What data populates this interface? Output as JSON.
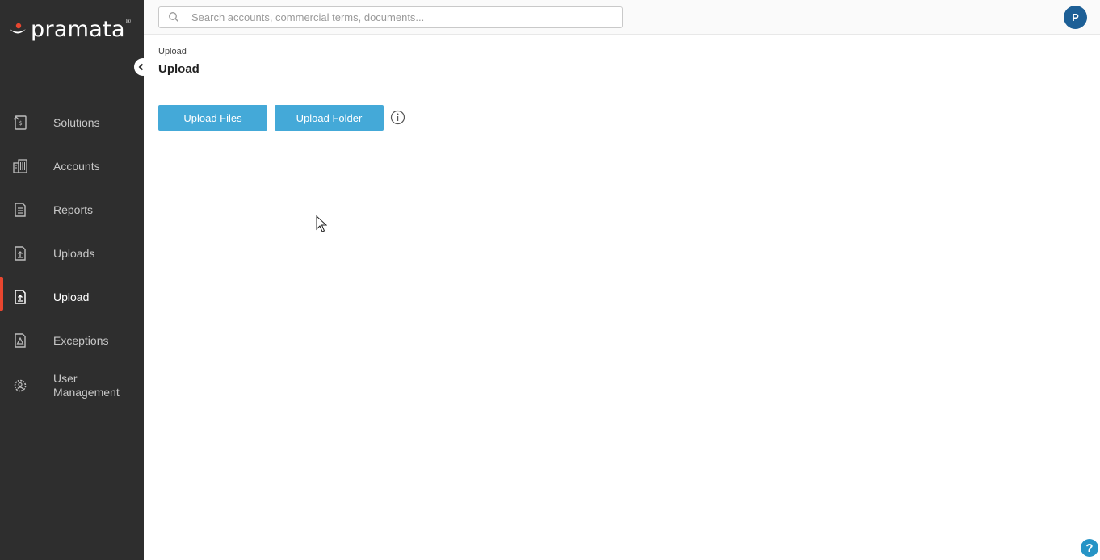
{
  "app": {
    "logo_text": "pramata",
    "logo_reg": "®"
  },
  "colors": {
    "sidebar_bg": "#2e2e2e",
    "active_indicator": "#e8462f",
    "button_primary": "#44a9d8",
    "avatar_bg": "#1d5f96",
    "help_bg": "#2694c6"
  },
  "search": {
    "placeholder": "Search accounts, commercial terms, documents...",
    "value": ""
  },
  "user": {
    "avatar_initial": "P"
  },
  "sidebar": {
    "items": [
      {
        "label": "Solutions",
        "icon": "solutions-icon",
        "active": false
      },
      {
        "label": "Accounts",
        "icon": "accounts-icon",
        "active": false
      },
      {
        "label": "Reports",
        "icon": "reports-icon",
        "active": false
      },
      {
        "label": "Uploads",
        "icon": "uploads-icon",
        "active": false
      },
      {
        "label": "Upload",
        "icon": "upload-icon",
        "active": true
      },
      {
        "label": "Exceptions",
        "icon": "exceptions-icon",
        "active": false
      },
      {
        "label": "User Management",
        "icon": "user-management-icon",
        "active": false
      }
    ]
  },
  "main": {
    "breadcrumb": "Upload",
    "title": "Upload",
    "buttons": {
      "upload_files": "Upload Files",
      "upload_folder": "Upload Folder"
    }
  },
  "help": {
    "label": "?"
  }
}
